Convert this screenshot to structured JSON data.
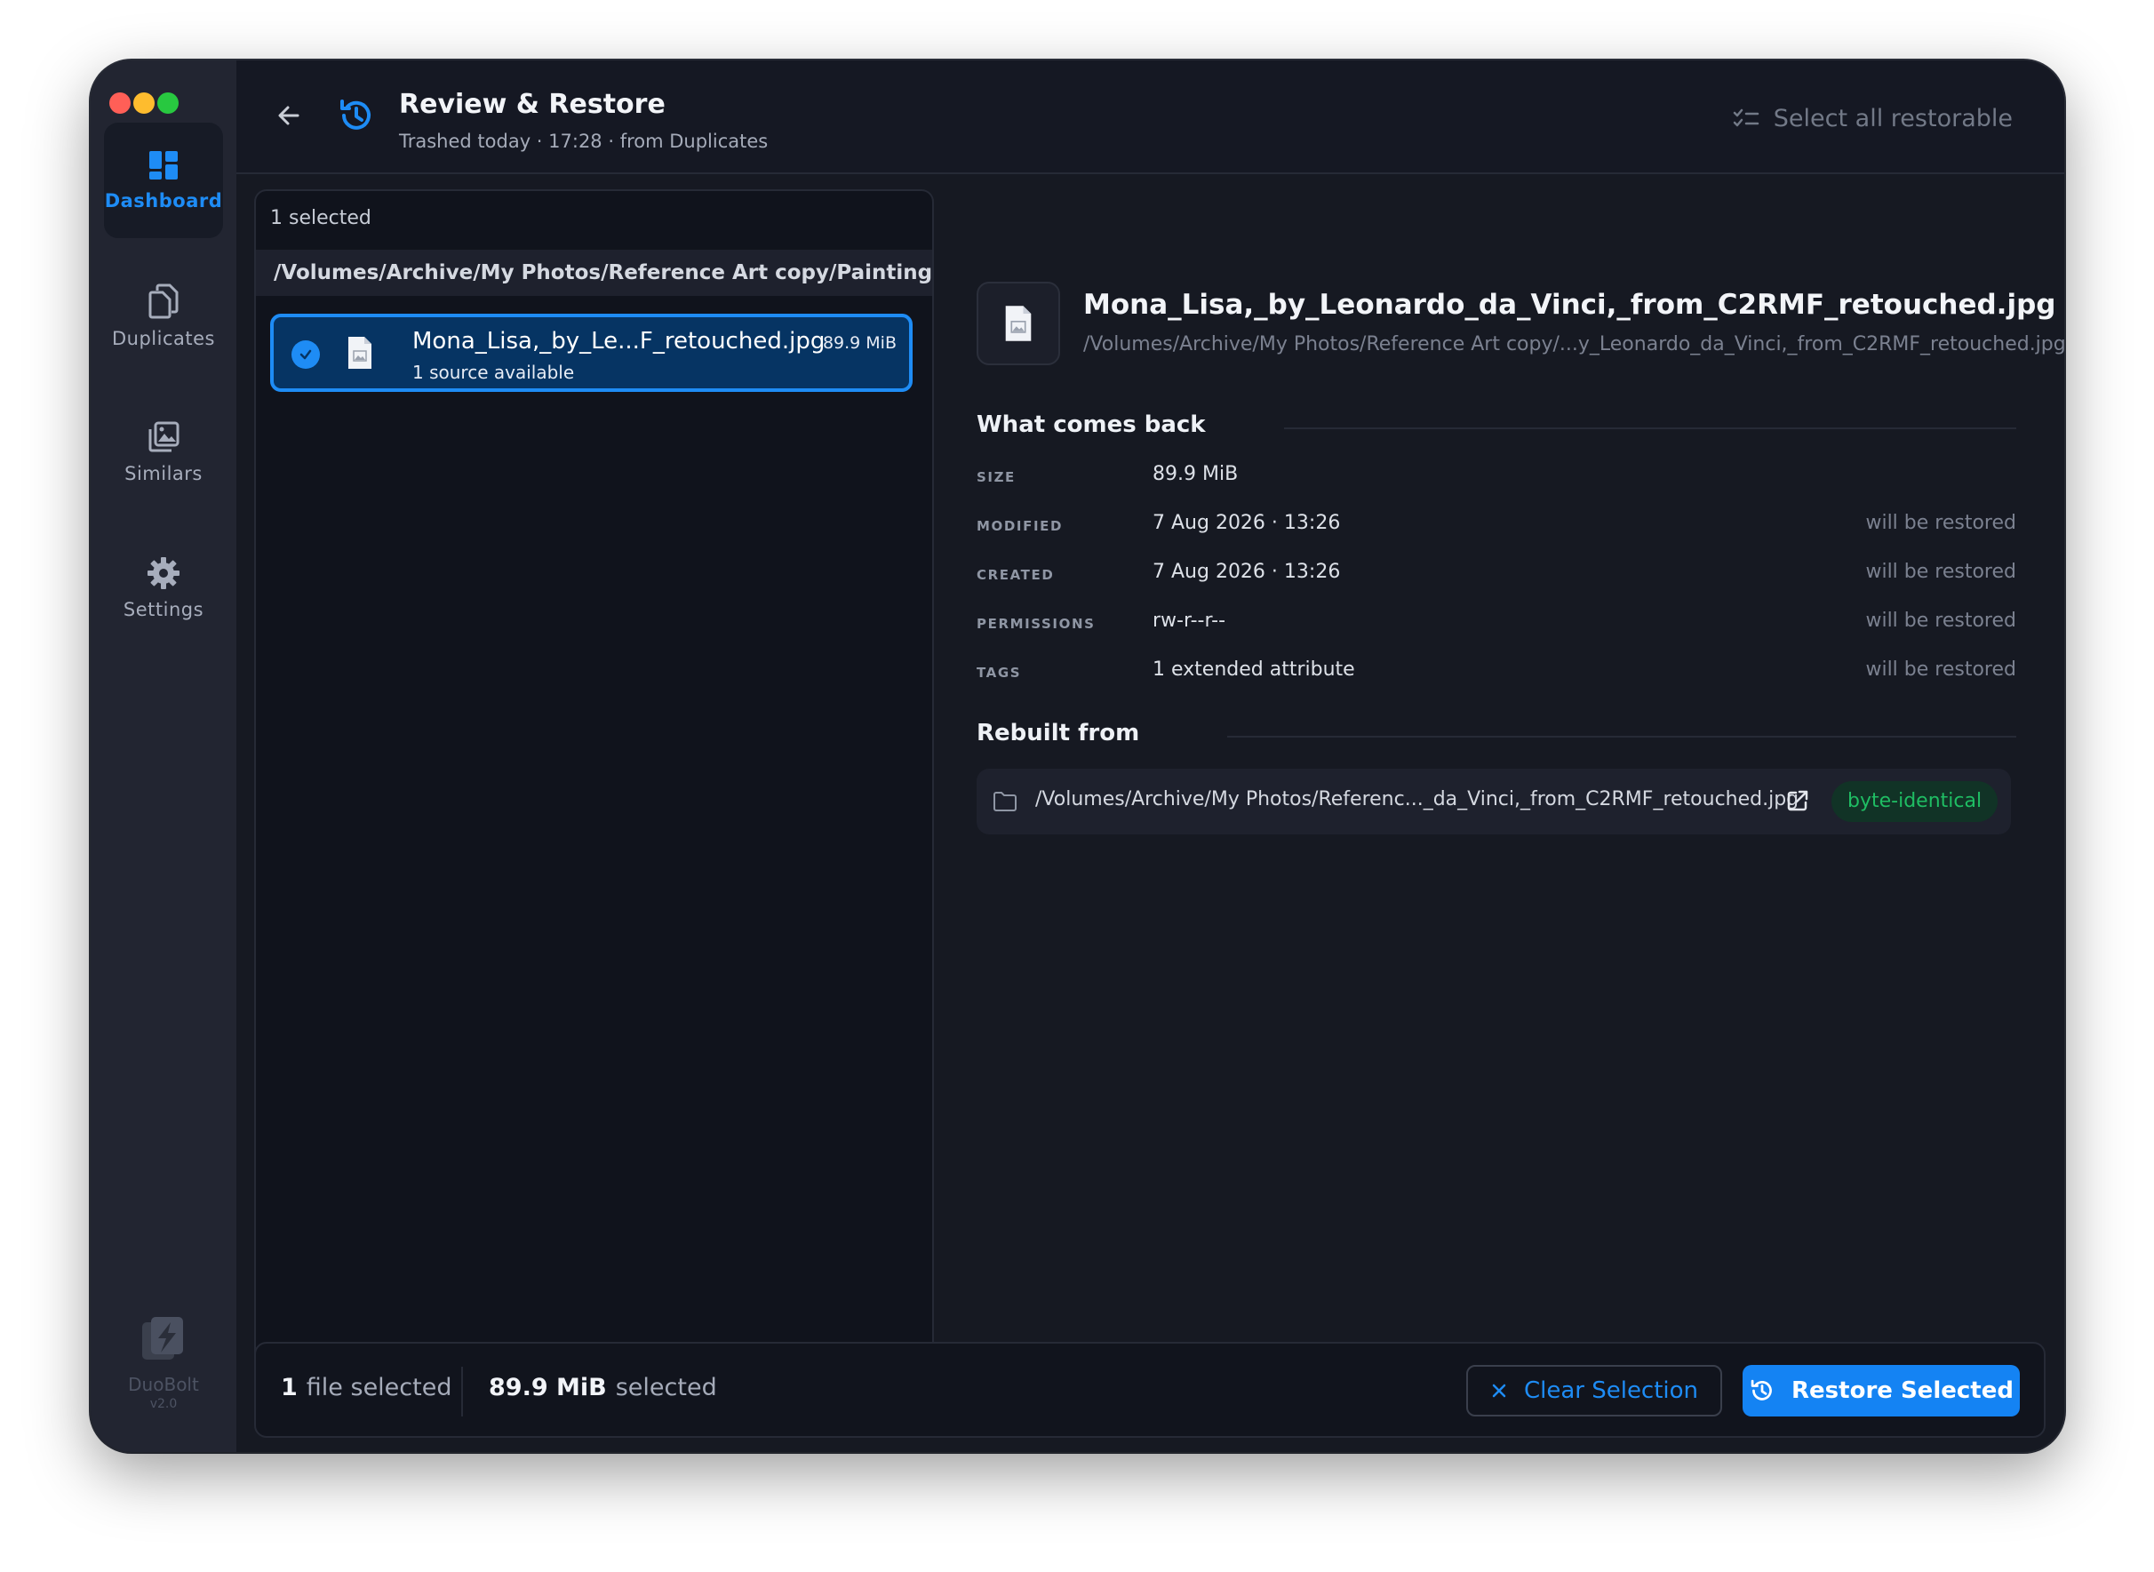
{
  "header": {
    "title": "Review & Restore",
    "subtitle": "Trashed today · 17:28 · from Duplicates",
    "select_all_label": "Select all restorable"
  },
  "sidebar": {
    "items": [
      {
        "label": "Dashboard",
        "icon": "dashboard-icon",
        "active": true
      },
      {
        "label": "Duplicates",
        "icon": "duplicates-icon",
        "active": false
      },
      {
        "label": "Similars",
        "icon": "similars-icon",
        "active": false
      },
      {
        "label": "Settings",
        "icon": "gear-icon",
        "active": false
      }
    ],
    "brand_name": "DuoBolt",
    "version": "v2.0"
  },
  "list": {
    "selected_count_label": "1 selected",
    "folder_path": "/Volumes/Archive/My Photos/Reference Art copy/Paintings",
    "files": [
      {
        "name": "Mona_Lisa,_by_Le...F_retouched.jpg",
        "sources": "1 source available",
        "size": "89.9 MiB",
        "selected": true
      }
    ]
  },
  "detail": {
    "file_name": "Mona_Lisa,_by_Leonardo_da_Vinci,_from_C2RMF_retouched.jpg",
    "file_path": "/Volumes/Archive/My Photos/Reference Art copy/...y_Leonardo_da_Vinci,_from_C2RMF_retouched.jpg",
    "what_comes_back_title": "What comes back",
    "properties": [
      {
        "label": "SIZE",
        "value": "89.9 MiB",
        "note": ""
      },
      {
        "label": "MODIFIED",
        "value": "7 Aug 2026 · 13:26",
        "note": "will be restored"
      },
      {
        "label": "CREATED",
        "value": "7 Aug 2026 · 13:26",
        "note": "will be restored"
      },
      {
        "label": "PERMISSIONS",
        "value": "rw-r--r--",
        "note": "will be restored"
      },
      {
        "label": "TAGS",
        "value": "1 extended attribute",
        "note": "will be restored"
      }
    ],
    "rebuilt_from_title": "Rebuilt from",
    "source": {
      "path": "/Volumes/Archive/My Photos/Referenc..._da_Vinci,_from_C2RMF_retouched.jpg",
      "badge": "byte-identical"
    }
  },
  "footer": {
    "file_count": "1",
    "file_count_label": "file selected",
    "size_value": "89.9 MiB",
    "size_label": "selected",
    "clear_label": "Clear Selection",
    "restore_label": "Restore Selected"
  },
  "colors": {
    "accent": "#1e8cf5",
    "success": "#1fbd63",
    "window_bg": "#161922",
    "sidebar_bg": "#222531",
    "traffic_red": "#ff5f57",
    "traffic_yellow": "#febc2e",
    "traffic_green": "#28c840"
  }
}
